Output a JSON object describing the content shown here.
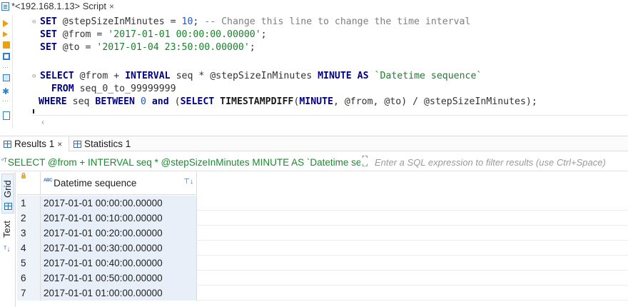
{
  "editor_tab": {
    "title": "*<192.168.1.13> Script",
    "close": "×"
  },
  "code": {
    "line1": {
      "kw": "SET",
      "var": " @stepSizeInMinutes = ",
      "num": "10",
      "rest": "; ",
      "comment": "-- Change this line to change the time interval"
    },
    "line2": {
      "kw": "SET",
      "var": " @from = ",
      "str": "'2017-01-01 00:00:00.00000'",
      "rest": ";"
    },
    "line3": {
      "kw": "SET",
      "var": " @to = ",
      "str": "'2017-01-04 23:50:00.00000'",
      "rest": ";"
    },
    "line5": {
      "kw1": "SELECT",
      "a": " @from + ",
      "kw2": "INTERVAL",
      "b": " seq * @stepSizeInMinutes ",
      "kw3": "MINUTE",
      "c": " ",
      "kw4": "AS",
      "d": " ",
      "alias": "`Datetime sequence`"
    },
    "line6": {
      "kw": "  FROM",
      "rest": " seq_0_to_99999999"
    },
    "line7": {
      "kw1": "WHERE",
      "a": " seq ",
      "kw2": "BETWEEN",
      "b": " ",
      "num": "0",
      "c": " ",
      "kw3": "and",
      "d": " (",
      "kw4": "SELECT",
      "e": " ",
      "fn": "TIMESTAMPDIFF",
      "f": "(",
      "kw5": "MINUTE",
      "g": ", @from, @to) / @stepSizeInMinutes);"
    }
  },
  "result_tabs": {
    "results_label": "Results 1",
    "results_close": "×",
    "statistics_label": "Statistics 1"
  },
  "filter": {
    "query_text": "SELECT @from + INTERVAL seq * @stepSizeInMinutes MINUTE AS `Datetime sequence`",
    "placeholder": "Enter a SQL expression to filter results (use Ctrl+Space)"
  },
  "side_tabs": {
    "grid": "Grid",
    "text": "Text"
  },
  "grid": {
    "column_header": "Datetime sequence",
    "rows": [
      {
        "num": "1",
        "value": "2017-01-01 00:00:00.00000"
      },
      {
        "num": "2",
        "value": "2017-01-01 00:10:00.00000"
      },
      {
        "num": "3",
        "value": "2017-01-01 00:20:00.00000"
      },
      {
        "num": "4",
        "value": "2017-01-01 00:30:00.00000"
      },
      {
        "num": "5",
        "value": "2017-01-01 00:40:00.00000"
      },
      {
        "num": "6",
        "value": "2017-01-01 00:50:00.00000"
      },
      {
        "num": "7",
        "value": "2017-01-01 01:00:00.00000"
      }
    ]
  }
}
